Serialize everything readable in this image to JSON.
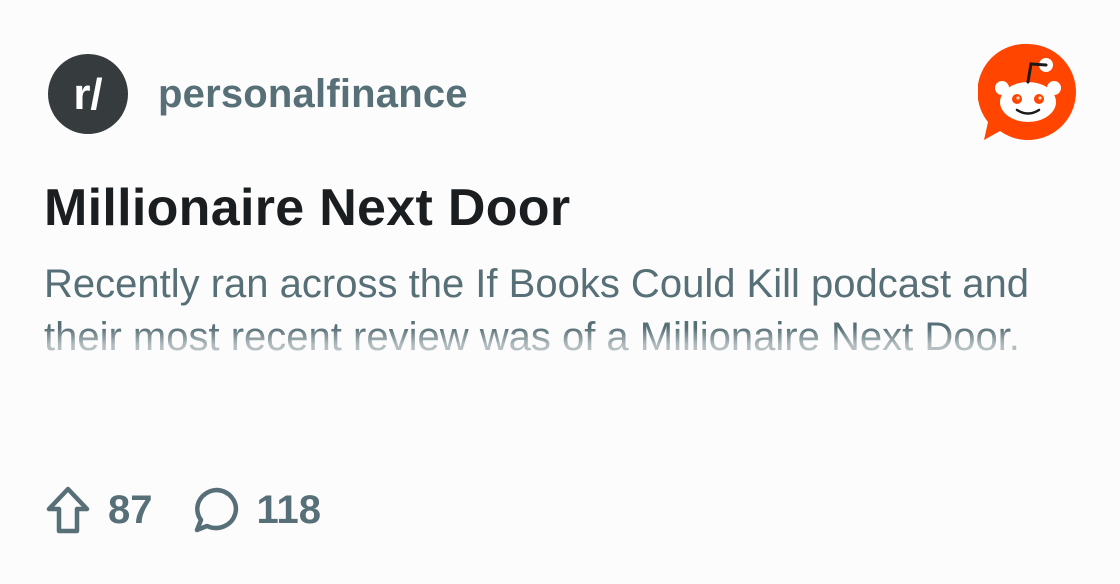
{
  "subreddit": {
    "prefix_icon": "r-slash-icon",
    "prefix_text": "r/",
    "name": "personalfinance"
  },
  "brand": {
    "icon": "reddit-snoo-logo",
    "accent_color": "#ff4500"
  },
  "post": {
    "title": "Millionaire Next Door",
    "body": "Recently ran across the If Books Could Kill podcast and their most recent review was of a Millionaire Next Door."
  },
  "stats": {
    "upvote_icon": "upvote-arrow-icon",
    "upvotes": "87",
    "comment_icon": "comment-bubble-icon",
    "comments": "118"
  },
  "colors": {
    "title": "#1a1e20",
    "meta": "#576f76",
    "avatar_bg": "#363b3e"
  }
}
